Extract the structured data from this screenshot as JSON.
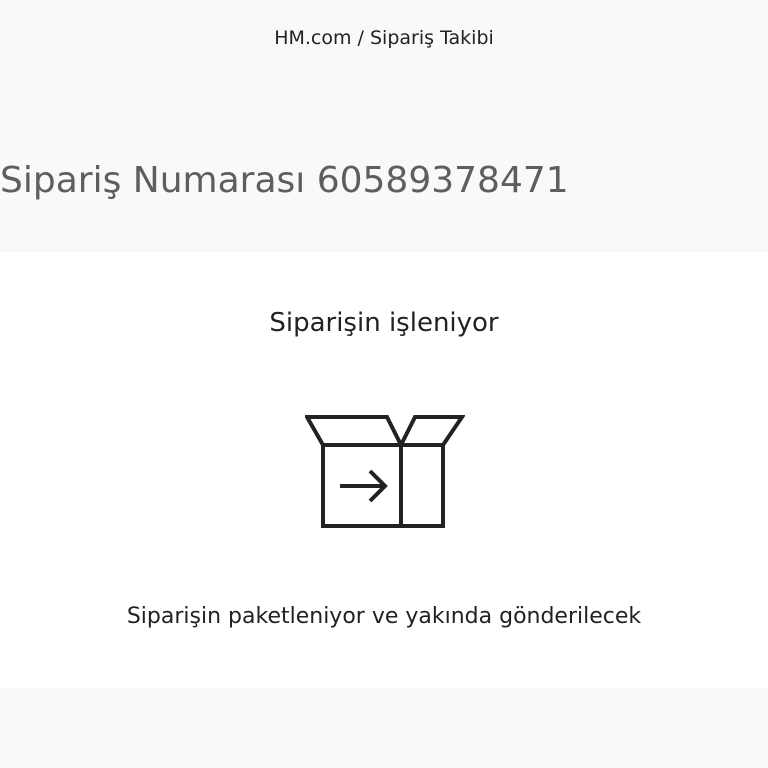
{
  "breadcrumb": {
    "home": "HM.com",
    "separator": " / ",
    "current": "Sipariş Takibi"
  },
  "order": {
    "title": "Sipariş Numarası 60589378471"
  },
  "status": {
    "title": "Siparişin işleniyor",
    "icon": "box-arrow-icon",
    "description": "Siparişin paketleniyor ve yakında gönderilecek"
  },
  "colors": {
    "background": "#faf9f8",
    "card": "#ffffff",
    "text": "#222222",
    "title_gray": "#5f5e5c"
  }
}
